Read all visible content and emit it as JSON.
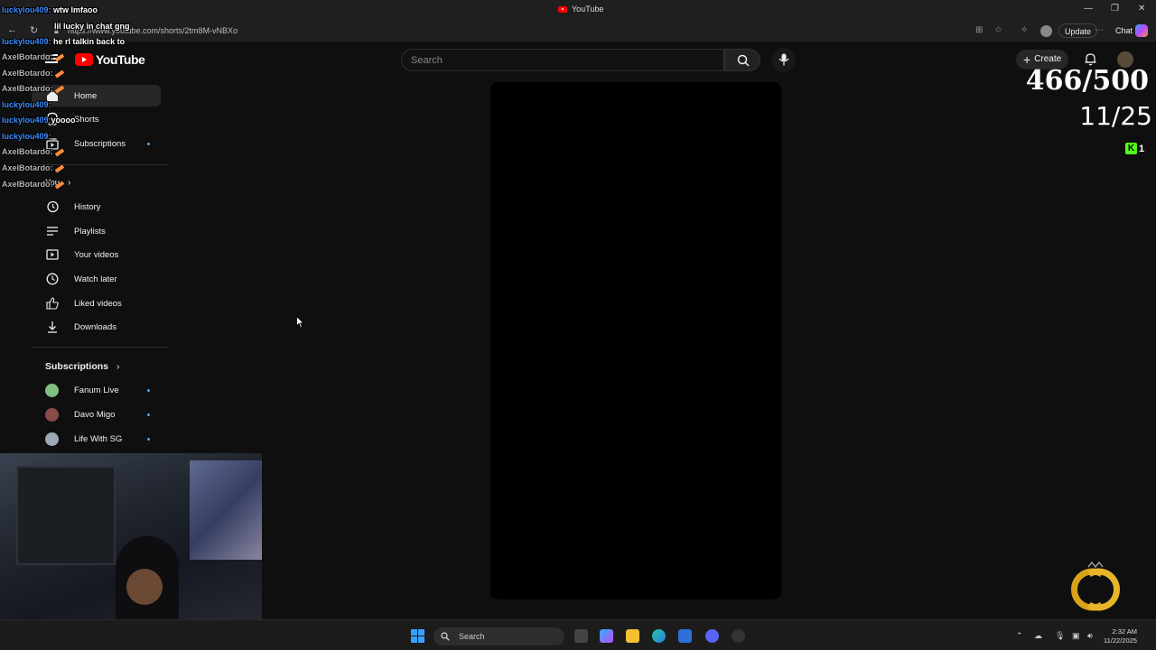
{
  "browser": {
    "tab_title": "YouTube",
    "url": "https://www.youtube.com/shorts/2tm8M-vNBXo",
    "update_label": "Update",
    "chat_label": "Chat"
  },
  "youtube": {
    "logo_text": "YouTube",
    "search_placeholder": "Search",
    "create_label": "Create",
    "sidebar": {
      "main": [
        {
          "label": "Home"
        },
        {
          "label": "Shorts"
        },
        {
          "label": "Subscriptions"
        }
      ],
      "you_label": "You",
      "you_items": [
        {
          "label": "History"
        },
        {
          "label": "Playlists"
        },
        {
          "label": "Your videos"
        },
        {
          "label": "Watch later"
        },
        {
          "label": "Liked videos"
        },
        {
          "label": "Downloads"
        }
      ],
      "subscriptions_label": "Subscriptions",
      "channels": [
        {
          "label": "Fanum Live",
          "color": "#7fbf7f"
        },
        {
          "label": "Davo Migo",
          "color": "#8a4a4a"
        },
        {
          "label": "Life With SG",
          "color": "#9aa8b8"
        }
      ]
    }
  },
  "overlay": {
    "chat": [
      {
        "user": "luckylou409:",
        "msg": "wtw lmfaoo",
        "user_color": "blue"
      },
      {
        "user": "",
        "msg": "lil lucky in chat gng",
        "user_color": "blue"
      },
      {
        "user": "luckylou409:",
        "msg": "he rl talkin back to",
        "user_color": "blue"
      },
      {
        "user": "AxelBotardo:",
        "msg": "",
        "user_color": "grey"
      },
      {
        "user": "AxelBotardo:",
        "msg": "",
        "user_color": "grey"
      },
      {
        "user": "AxelBotardo:",
        "msg": "",
        "user_color": "grey"
      },
      {
        "user": "luckylou409:",
        "msg": "",
        "user_color": "blue"
      },
      {
        "user": "luckylou409:",
        "msg": "yoooo",
        "user_color": "blue"
      },
      {
        "user": "luckylou409:",
        "msg": "",
        "user_color": "blue"
      },
      {
        "user": "AxelBotardo:",
        "msg": "",
        "user_color": "grey"
      },
      {
        "user": "AxelBotardo:",
        "msg": "",
        "user_color": "grey"
      },
      {
        "user": "AxelBotardo:",
        "msg": "",
        "user_color": "grey"
      }
    ],
    "counter_main": "466/500",
    "counter_sub": "11/25",
    "kick_count": "1"
  },
  "taskbar": {
    "search_label": "Search",
    "time": "2:32 AM",
    "date": "11/22/2025"
  }
}
